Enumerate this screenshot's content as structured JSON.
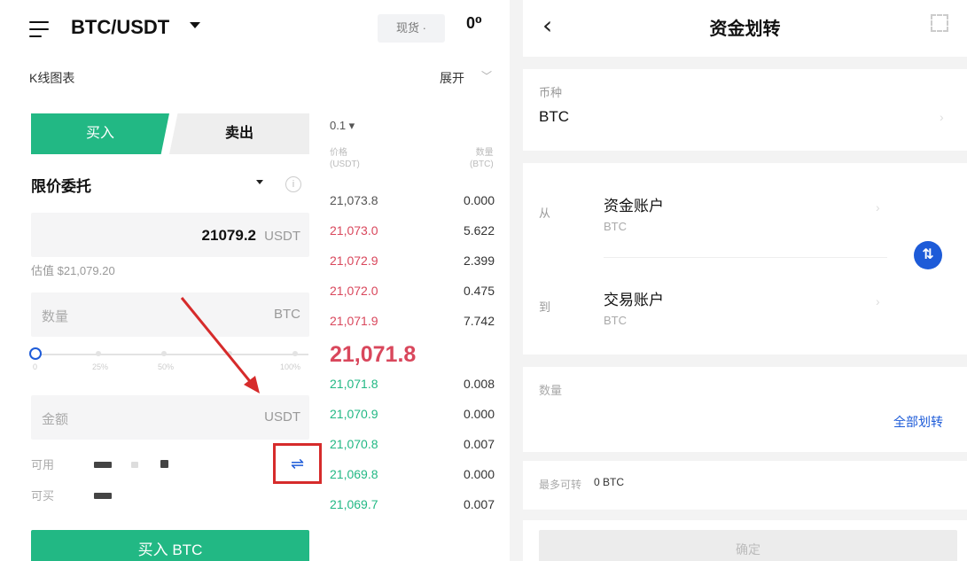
{
  "trade": {
    "pair": "BTC/USDT",
    "mode_tab": "现货 ·",
    "top_icon": "0⁰",
    "kline_label": "K线图表",
    "expand_label": "展开",
    "buy_tab": "买入",
    "sell_tab": "卖出",
    "order_type": "限价委托",
    "price_value": "21079.2",
    "price_unit": "USDT",
    "estimate": "估值 $21,079.20",
    "qty_placeholder": "数量",
    "qty_unit": "BTC",
    "slider_labels": [
      "0",
      "25%",
      "50%",
      "100%"
    ],
    "amount_placeholder": "金额",
    "amount_unit": "USDT",
    "available_label": "可用",
    "buyable_label": "可买",
    "swap_icon": "⇌",
    "buy_button": "买入 BTC"
  },
  "orderbook": {
    "step": "0.1 ▾",
    "price_header": [
      "价格",
      "(USDT)"
    ],
    "amount_header": [
      "数量",
      "(BTC)"
    ],
    "asks": [
      {
        "price": "21,073.8",
        "amount": "0.000"
      },
      {
        "price": "21,073.0",
        "amount": "5.622"
      },
      {
        "price": "21,072.9",
        "amount": "2.399"
      },
      {
        "price": "21,072.0",
        "amount": "0.475"
      },
      {
        "price": "21,071.9",
        "amount": "7.742"
      }
    ],
    "last_price": "21,071.8",
    "bids": [
      {
        "price": "21,071.8",
        "amount": "0.008"
      },
      {
        "price": "21,070.9",
        "amount": "0.000"
      },
      {
        "price": "21,070.8",
        "amount": "0.007"
      },
      {
        "price": "21,069.8",
        "amount": "0.000"
      },
      {
        "price": "21,069.7",
        "amount": "0.007"
      }
    ]
  },
  "transfer": {
    "back_icon": "‹",
    "title": "资金划转",
    "coin_label": "币种",
    "coin_value": "BTC",
    "from_label": "从",
    "from_account": "资金账户",
    "from_sub": "BTC",
    "to_label": "到",
    "to_account": "交易账户",
    "to_sub": "BTC",
    "switch_icon": "⇅",
    "qty_label": "数量",
    "all_button": "全部划转",
    "max_label": "最多可转",
    "max_value": "0 BTC",
    "confirm": "确定"
  },
  "colors": {
    "buy_green": "#22b884",
    "ask_red": "#d9475c",
    "accent_blue": "#1d5bd8",
    "highlight_red": "#d62b2b"
  }
}
